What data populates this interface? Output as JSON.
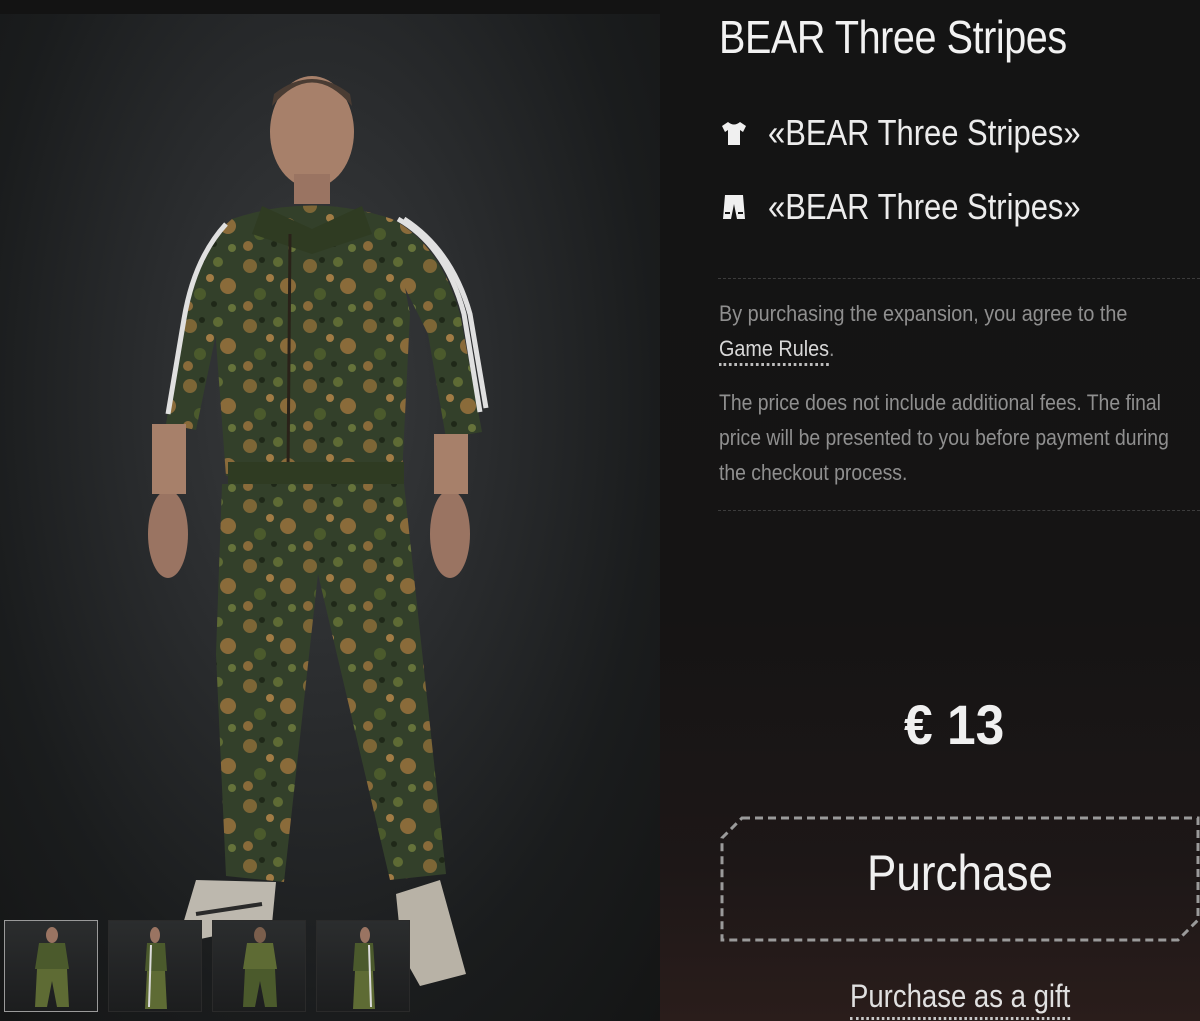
{
  "product": {
    "title": "BEAR Three Stripes",
    "items": [
      {
        "icon": "tshirt-icon",
        "name": "«BEAR Three Stripes»"
      },
      {
        "icon": "pants-icon",
        "name": "«BEAR Three Stripes»"
      }
    ]
  },
  "legal": {
    "agree_prefix": "By purchasing the expansion, you agree to the",
    "rules_link": "Game Rules",
    "agree_suffix": ".",
    "fees_note": "The price does not include additional fees. The final price will be presented to you before payment during the checkout process."
  },
  "price": {
    "display": "€ 13"
  },
  "actions": {
    "purchase_label": "Purchase",
    "gift_label": "Purchase as a gift"
  },
  "gallery": {
    "thumbnails": [
      "front view",
      "side view",
      "back view",
      "side view right"
    ],
    "active_index": 0
  },
  "colors": {
    "background": "#131313",
    "camo_dark": "#2f3b22",
    "camo_mid": "#5c6a34",
    "camo_tan": "#8a6b3a",
    "text_primary": "#f0f0f0",
    "text_muted": "#8f8f8f"
  }
}
